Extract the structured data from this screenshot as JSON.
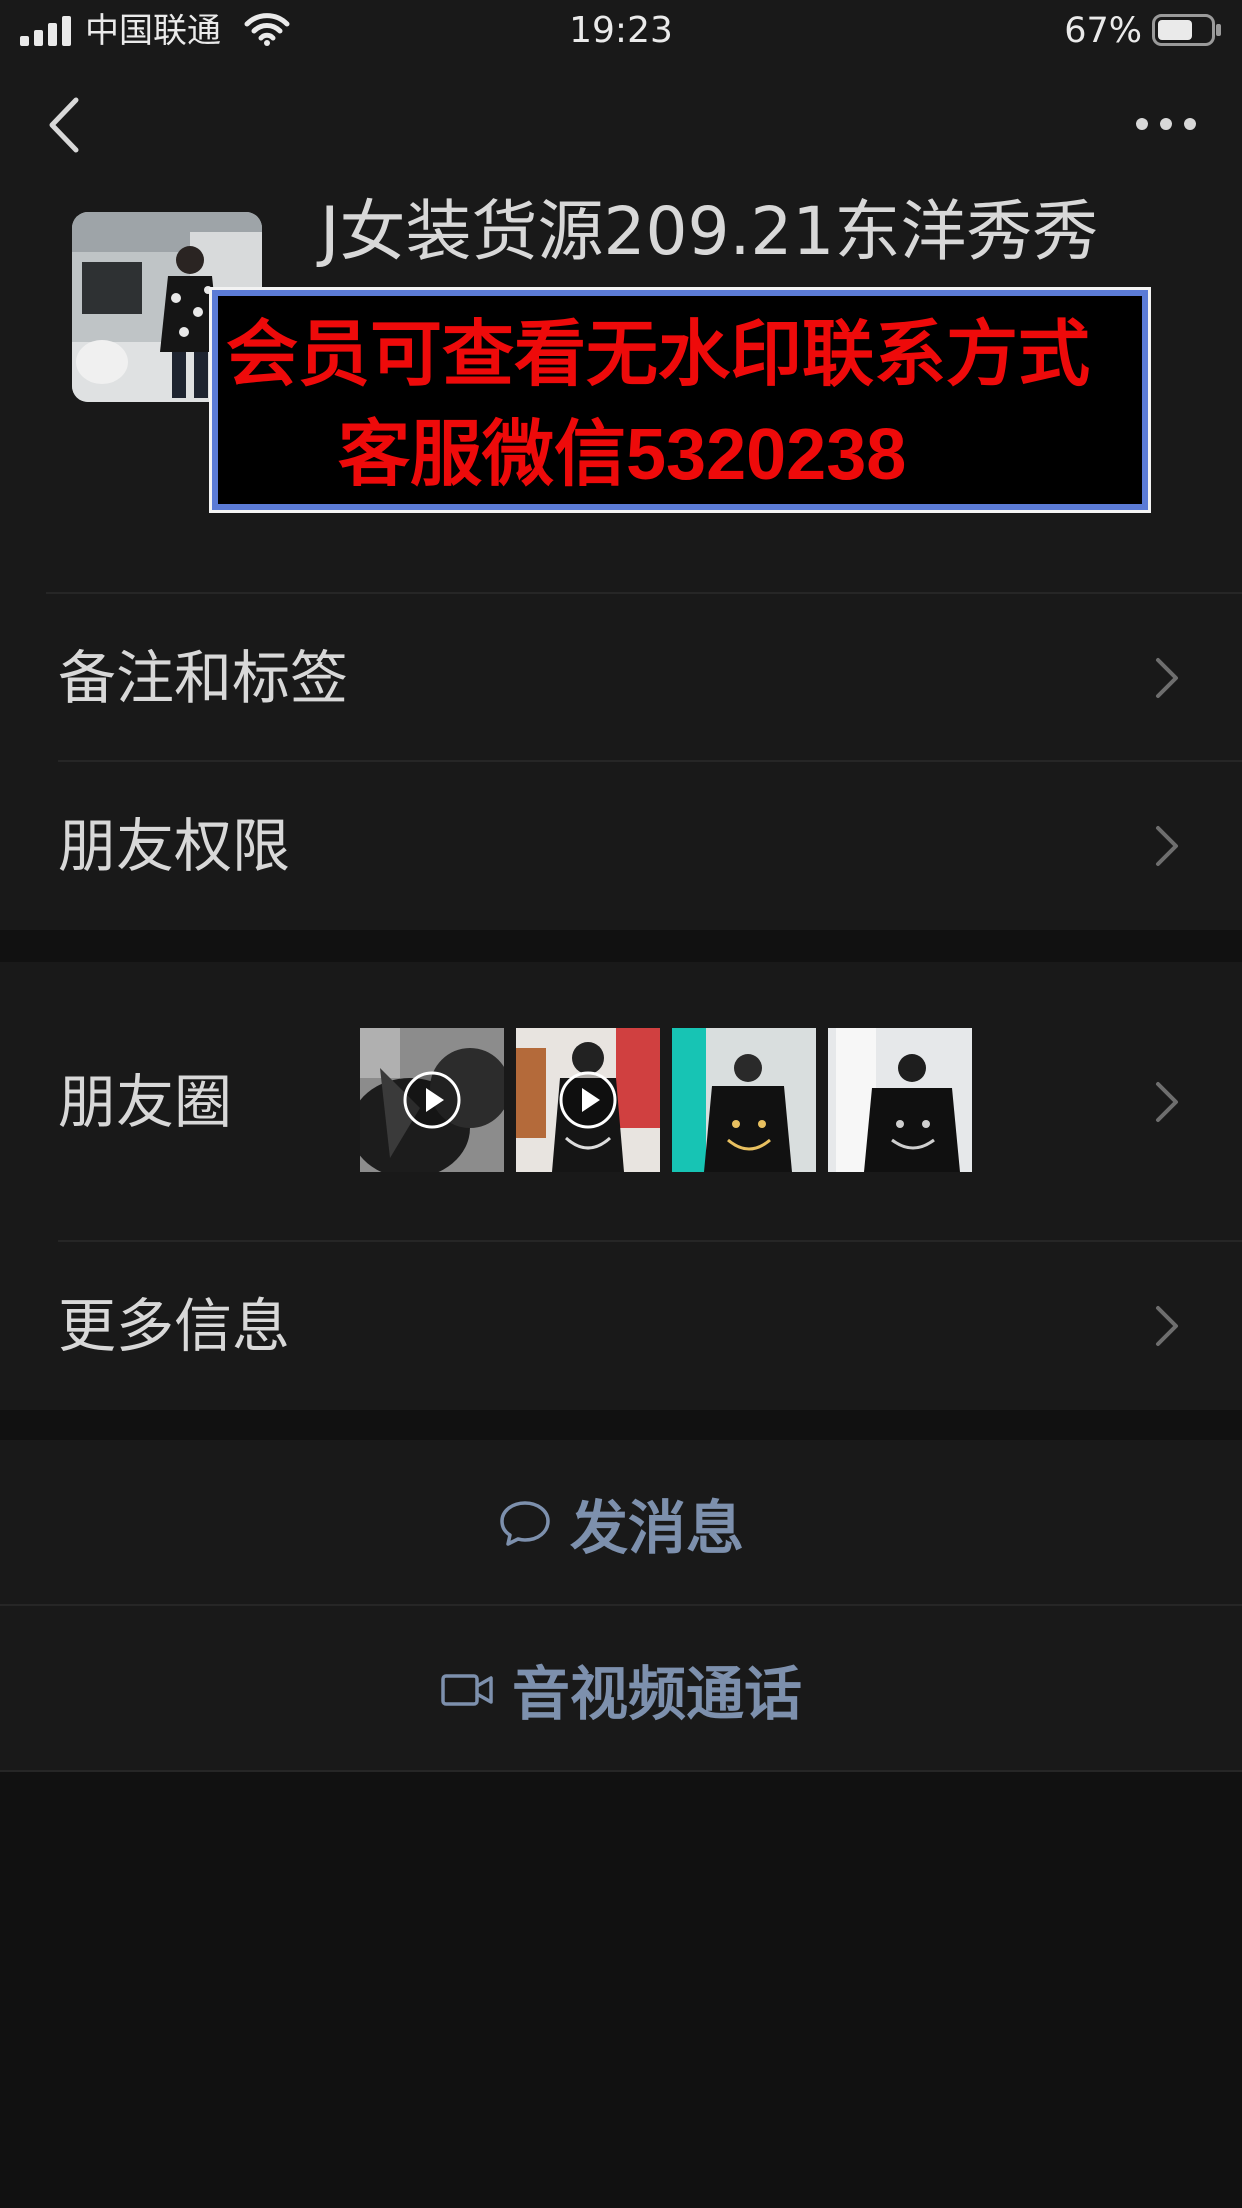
{
  "status_bar": {
    "carrier": "中国联通",
    "time": "19:23",
    "battery_percent": "67%",
    "battery_level": 0.67,
    "signal_icon": "signal-bars-icon",
    "wifi_icon": "wifi-icon",
    "battery_icon": "battery-icon"
  },
  "nav": {
    "back_icon": "chevron-left-icon",
    "more_icon": "more-dots-icon"
  },
  "profile": {
    "name": "J女装货源209.21东洋秀秀",
    "watermark_line1": "会员可查看无水印联系方式",
    "watermark_line2": "客服微信5320238"
  },
  "rows": {
    "remarks": "备注和标签",
    "permissions": "朋友权限",
    "moments": "朋友圈",
    "more_info": "更多信息"
  },
  "moments_thumbnails": [
    {
      "kind": "video",
      "icon": "play-icon"
    },
    {
      "kind": "video",
      "icon": "play-icon"
    },
    {
      "kind": "image"
    },
    {
      "kind": "image"
    }
  ],
  "actions": {
    "message": "发消息",
    "message_icon": "chat-bubble-icon",
    "call": "音视频通话",
    "call_icon": "video-camera-icon"
  },
  "colors": {
    "background": "#111111",
    "panel": "#191919",
    "text": "#d8d8d8",
    "action_text": "#7d90ad",
    "watermark_text": "#ee0a0a",
    "watermark_border": "#5b7bd6"
  }
}
